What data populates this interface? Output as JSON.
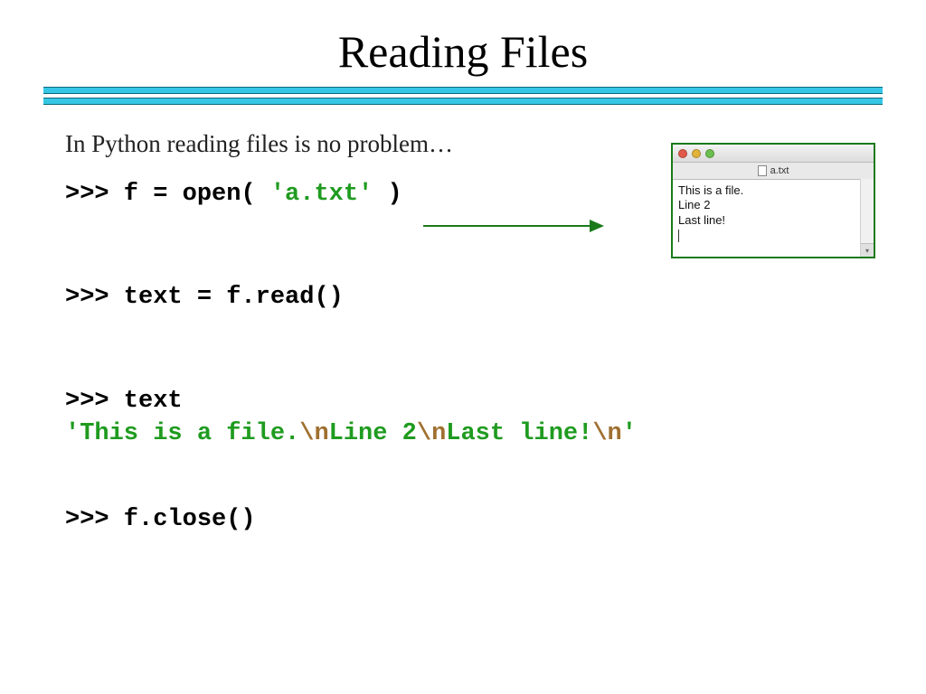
{
  "title": "Reading Files",
  "intro": "In Python reading files is no problem…",
  "code": {
    "line1_prompt": ">>> f = open( ",
    "line1_str": "'a.txt'",
    "line1_after": " )",
    "line2": ">>> text = f.read()",
    "line3": ">>> text",
    "out_q1": "'",
    "out_p1": "This is a file.",
    "out_e1": "\\n",
    "out_p2": "Line 2",
    "out_e2": "\\n",
    "out_p3": "Last line!",
    "out_e3": "\\n",
    "out_q2": "'",
    "line5": ">>> f.close()"
  },
  "file_window": {
    "filename": "a.txt",
    "lines": [
      "This is a file.",
      "Line 2",
      "Last line!"
    ]
  },
  "colors": {
    "rule": "#36c6e6",
    "string": "#1f9b1f",
    "escape": "#a07030",
    "arrow": "#1a7a1a",
    "window_border": "#1a7a1a"
  }
}
